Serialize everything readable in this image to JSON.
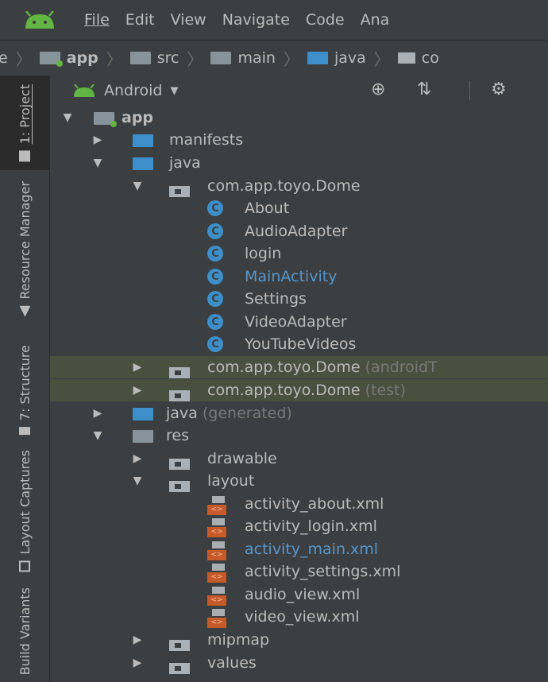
{
  "menubar": {
    "items": [
      {
        "label": "File"
      },
      {
        "label": "Edit"
      },
      {
        "label": "View"
      },
      {
        "label": "Navigate"
      },
      {
        "label": "Code"
      },
      {
        "label": "Ana"
      }
    ]
  },
  "breadcrumb": {
    "items": [
      "e",
      "app",
      "src",
      "main",
      "java",
      "co"
    ]
  },
  "leftbar": {
    "items": [
      {
        "label": "1: Project"
      },
      {
        "label": "Resource Manager"
      },
      {
        "label": "7: Structure"
      },
      {
        "label": "Layout Captures"
      },
      {
        "label": "Build Variants"
      }
    ]
  },
  "panel": {
    "view_label": "Android"
  },
  "tree": {
    "app": "app",
    "manifests": "manifests",
    "java": "java",
    "pkg_main": "com.app.toyo.Dome",
    "classes": [
      "About",
      "AudioAdapter",
      "login",
      "MainActivity",
      "Settings",
      "VideoAdapter",
      "YouTubeVideos"
    ],
    "pkg_android_test": "com.app.toyo.Dome",
    "pkg_android_test_suffix": "(androidT",
    "pkg_test": "com.app.toyo.Dome",
    "pkg_test_suffix": "(test)",
    "java_generated": "java",
    "java_generated_suffix": "(generated)",
    "res": "res",
    "drawable": "drawable",
    "layout": "layout",
    "layout_files": [
      "activity_about.xml",
      "activity_login.xml",
      "activity_main.xml",
      "activity_settings.xml",
      "audio_view.xml",
      "video_view.xml"
    ],
    "mipmap": "mipmap",
    "values": "values"
  },
  "colors": {
    "background": "#3c3f41",
    "text": "#bbbbbb",
    "link_blue": "#5895c8",
    "android_green": "#62b543",
    "highlight_row": "#4a5040"
  }
}
